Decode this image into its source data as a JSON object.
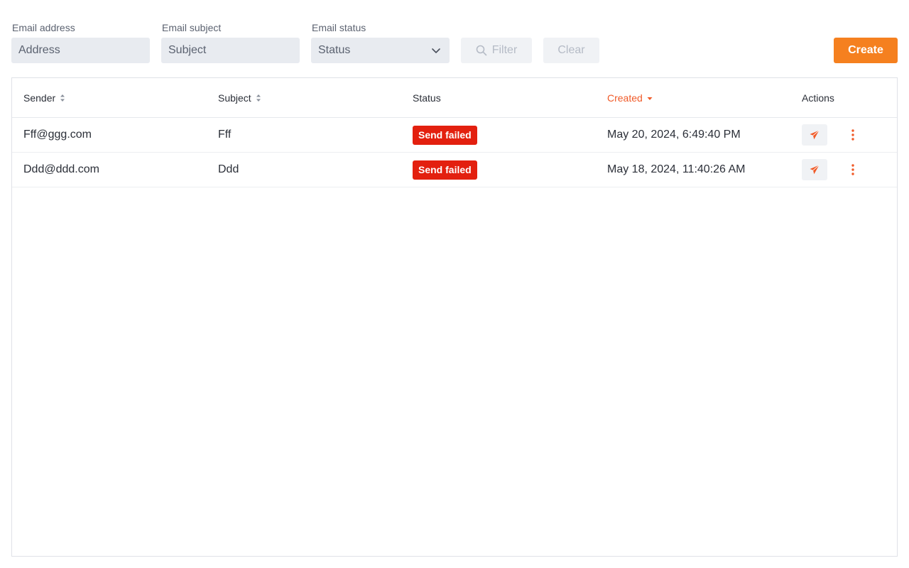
{
  "filters": {
    "address": {
      "label": "Email address",
      "placeholder": "Address"
    },
    "subject": {
      "label": "Email subject",
      "placeholder": "Subject"
    },
    "status": {
      "label": "Email status",
      "value": "Status"
    },
    "filter_label": "Filter",
    "clear_label": "Clear",
    "create_label": "Create"
  },
  "table": {
    "columns": {
      "sender": "Sender",
      "subject": "Subject",
      "status": "Status",
      "created": "Created",
      "actions": "Actions"
    },
    "sort": {
      "column": "created",
      "direction": "desc"
    },
    "rows": [
      {
        "sender": "Fff@ggg.com",
        "subject": "Fff",
        "status": "Send failed",
        "created": "May 20, 2024, 6:49:40 PM"
      },
      {
        "sender": "Ddd@ddd.com",
        "subject": "Ddd",
        "status": "Send failed",
        "created": "May 18, 2024, 11:40:26 AM"
      }
    ]
  },
  "icons": {
    "filter": "search-icon",
    "status_dropdown": "chevron-down-icon",
    "sort_inactive": "sort-icon",
    "sort_active": "sort-desc-icon",
    "send": "paper-plane-icon",
    "more": "more-vertical-icon"
  },
  "colors": {
    "accent": "#f5801f",
    "active_sort": "#f05a28",
    "badge_failed": "#e3200f",
    "action_icon": "#f05a28"
  }
}
